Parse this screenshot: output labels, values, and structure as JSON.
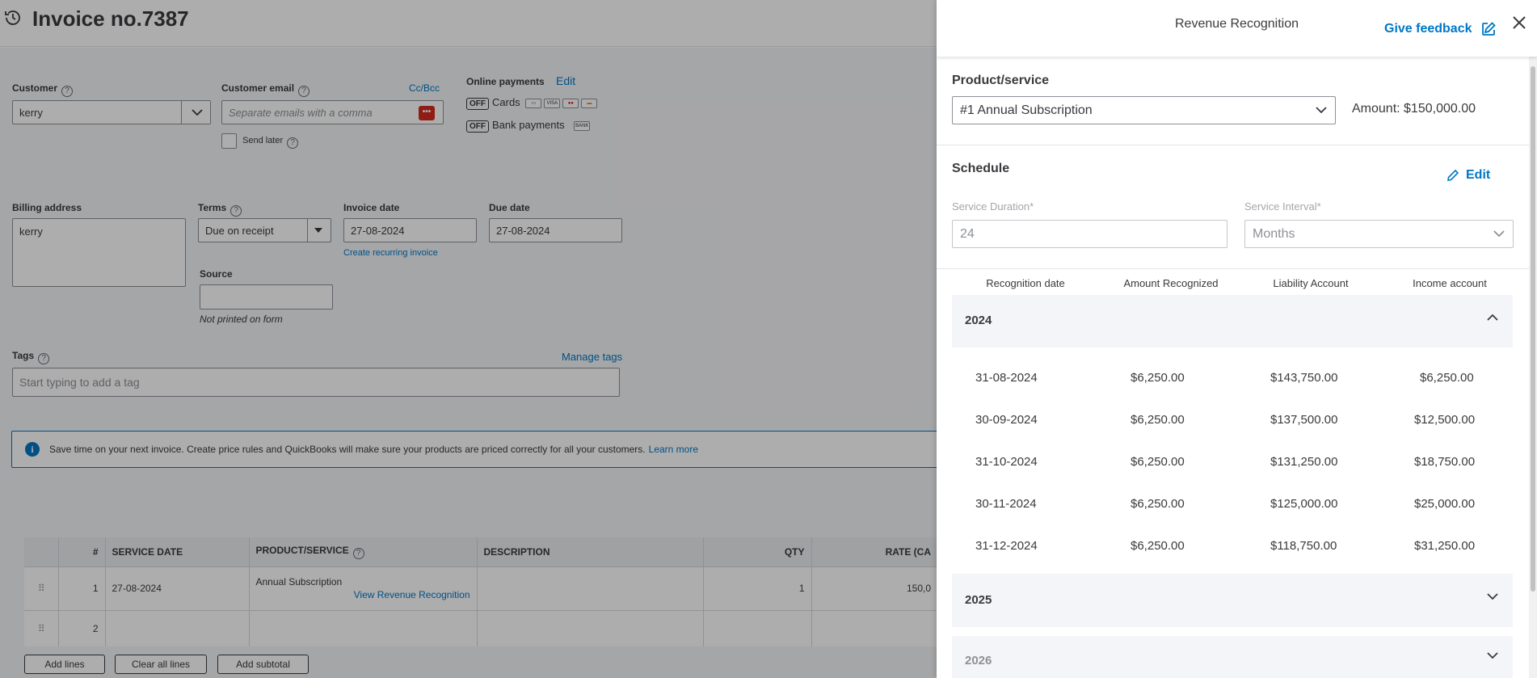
{
  "invoice": {
    "title": "Invoice no.7387",
    "customer_label": "Customer",
    "customer_value": "kerry",
    "email_label": "Customer email",
    "email_placeholder": "Separate emails with a comma",
    "cc_bcc": "Cc/Bcc",
    "send_later": "Send later",
    "online_payments_label": "Online payments",
    "online_payments_edit": "Edit",
    "off_badge": "OFF",
    "cards_label": "Cards",
    "bank_payments_label": "Bank payments",
    "billing_address_label": "Billing address",
    "billing_address_value": "kerry",
    "terms_label": "Terms",
    "terms_value": "Due on receipt",
    "invoice_date_label": "Invoice date",
    "invoice_date_value": "27-08-2024",
    "create_recurring": "Create recurring invoice",
    "due_date_label": "Due date",
    "due_date_value": "27-08-2024",
    "source_label": "Source",
    "not_printed": "Not printed on form",
    "tags_label": "Tags",
    "manage_tags": "Manage tags",
    "tags_placeholder": "Start typing to add a tag",
    "banner_text": "Save time on your next invoice. Create price rules and QuickBooks will make sure your products are priced correctly for all your customers.",
    "banner_link": "Learn more",
    "table": {
      "headers": [
        "",
        "#",
        "SERVICE DATE",
        "PRODUCT/SERVICE",
        "DESCRIPTION",
        "QTY",
        "RATE (CA"
      ],
      "row1": {
        "num": "1",
        "date": "27-08-2024",
        "product": "Annual Subscription",
        "view_link": "View Revenue Recognition",
        "qty": "1",
        "rate": "150,0"
      },
      "row2": {
        "num": "2"
      }
    },
    "buttons": {
      "add_lines": "Add lines",
      "clear_all": "Clear all lines",
      "add_subtotal": "Add subtotal"
    }
  },
  "panel": {
    "title": "Revenue Recognition",
    "feedback": "Give feedback",
    "product_label": "Product/service",
    "product_value": "#1 Annual Subscription",
    "amount": "Amount: $150,000.00",
    "schedule_label": "Schedule",
    "edit": "Edit",
    "duration_label": "Service Duration*",
    "duration_value": "24",
    "interval_label": "Service Interval*",
    "interval_value": "Months",
    "columns": [
      "Recognition date",
      "Amount Recognized",
      "Liability Account",
      "Income account"
    ],
    "years": {
      "y2024": "2024",
      "y2025": "2025",
      "y2026": "2026"
    },
    "rows": [
      {
        "date": "31-08-2024",
        "amount": "$6,250.00",
        "liability": "$143,750.00",
        "income": "$6,250.00"
      },
      {
        "date": "30-09-2024",
        "amount": "$6,250.00",
        "liability": "$137,500.00",
        "income": "$12,500.00"
      },
      {
        "date": "31-10-2024",
        "amount": "$6,250.00",
        "liability": "$131,250.00",
        "income": "$18,750.00"
      },
      {
        "date": "30-11-2024",
        "amount": "$6,250.00",
        "liability": "$125,000.00",
        "income": "$25,000.00"
      },
      {
        "date": "31-12-2024",
        "amount": "$6,250.00",
        "liability": "$118,750.00",
        "income": "$31,250.00"
      }
    ]
  },
  "colors": {
    "accent": "#0077c5",
    "text": "#393a3d",
    "muted": "#8d9096"
  }
}
